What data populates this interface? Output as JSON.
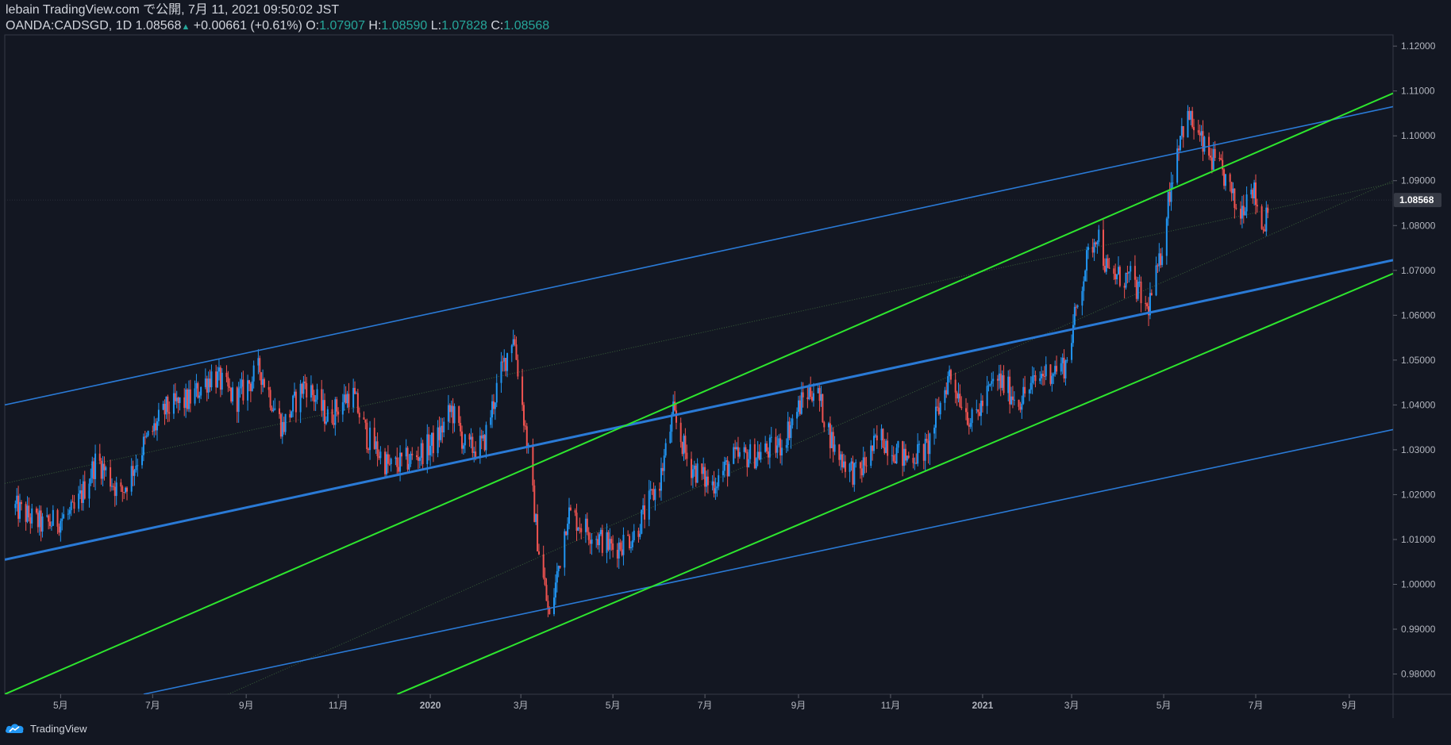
{
  "header": {
    "published": "lebain TradingView.com で公開, 7月 11, 2021 09:50:02 JST",
    "symbol": "OANDA:CADSGD, 1D",
    "last": "1.08568",
    "change_arrow": "▲",
    "change": "+0.00661 (+0.61%)",
    "o_label": "O:",
    "o_val": "1.07907",
    "h_label": "H:",
    "h_val": "1.08590",
    "l_label": "L:",
    "l_val": "1.07828",
    "c_label": "C:",
    "c_val": "1.08568"
  },
  "footer": {
    "brand": "TradingView",
    "logo_icon": "tradingview-cloud-icon"
  },
  "colors": {
    "background": "#131722",
    "up": "#2196f3",
    "down": "#ef5350",
    "blue_line": "#2a7ad6",
    "green_line": "#2ee62e",
    "axis_text": "#b2b5be"
  },
  "chart_data": {
    "type": "candlestick",
    "symbol": "OANDA:CADSGD",
    "interval": "1D",
    "last_price_label": "1.08568",
    "ylim": [
      0.9755,
      1.1225
    ],
    "y_ticks": [
      "1.12000",
      "1.11000",
      "1.10000",
      "1.09000",
      "1.08000",
      "1.07000",
      "1.06000",
      "1.05000",
      "1.04000",
      "1.03000",
      "1.02000",
      "1.01000",
      "1.00000",
      "0.99000",
      "0.98000"
    ],
    "x_ticks": [
      "5月",
      "7月",
      "9月",
      "11月",
      "2020",
      "3月",
      "5月",
      "7月",
      "9月",
      "11月",
      "2021",
      "3月",
      "5月",
      "7月",
      "9月"
    ],
    "close_path": [
      [
        "2019-04-01",
        1.017
      ],
      [
        "2019-04-20",
        1.013
      ],
      [
        "2019-05-10",
        1.016
      ],
      [
        "2019-05-25",
        1.028
      ],
      [
        "2019-06-10",
        1.02
      ],
      [
        "2019-06-25",
        1.031
      ],
      [
        "2019-07-10",
        1.039
      ],
      [
        "2019-07-25",
        1.041
      ],
      [
        "2019-08-10",
        1.047
      ],
      [
        "2019-08-25",
        1.041
      ],
      [
        "2019-09-10",
        1.048
      ],
      [
        "2019-09-25",
        1.035
      ],
      [
        "2019-10-10",
        1.045
      ],
      [
        "2019-10-25",
        1.037
      ],
      [
        "2019-11-10",
        1.043
      ],
      [
        "2019-11-20",
        1.033
      ],
      [
        "2019-12-05",
        1.026
      ],
      [
        "2019-12-20",
        1.028
      ],
      [
        "2020-01-05",
        1.032
      ],
      [
        "2020-01-15",
        1.039
      ],
      [
        "2020-01-25",
        1.03
      ],
      [
        "2020-02-05",
        1.031
      ],
      [
        "2020-02-15",
        1.045
      ],
      [
        "2020-02-25",
        1.056
      ],
      [
        "2020-03-05",
        1.032
      ],
      [
        "2020-03-12",
        1.01
      ],
      [
        "2020-03-20",
        0.992
      ],
      [
        "2020-04-01",
        1.016
      ],
      [
        "2020-04-15",
        1.012
      ],
      [
        "2020-05-01",
        1.008
      ],
      [
        "2020-05-15",
        1.011
      ],
      [
        "2020-06-01",
        1.023
      ],
      [
        "2020-06-10",
        1.038
      ],
      [
        "2020-06-20",
        1.027
      ],
      [
        "2020-07-05",
        1.022
      ],
      [
        "2020-07-20",
        1.028
      ],
      [
        "2020-08-05",
        1.029
      ],
      [
        "2020-08-20",
        1.031
      ],
      [
        "2020-09-05",
        1.042
      ],
      [
        "2020-09-12",
        1.044
      ],
      [
        "2020-09-25",
        1.03
      ],
      [
        "2020-10-10",
        1.024
      ],
      [
        "2020-10-25",
        1.033
      ],
      [
        "2020-11-10",
        1.028
      ],
      [
        "2020-11-25",
        1.03
      ],
      [
        "2020-12-10",
        1.047
      ],
      [
        "2020-12-25",
        1.036
      ],
      [
        "2021-01-10",
        1.046
      ],
      [
        "2021-01-25",
        1.041
      ],
      [
        "2021-02-10",
        1.047
      ],
      [
        "2021-02-25",
        1.049
      ],
      [
        "2021-03-10",
        1.071
      ],
      [
        "2021-03-18",
        1.079
      ],
      [
        "2021-03-25",
        1.069
      ],
      [
        "2021-04-10",
        1.068
      ],
      [
        "2021-04-20",
        1.061
      ],
      [
        "2021-04-28",
        1.071
      ],
      [
        "2021-05-05",
        1.088
      ],
      [
        "2021-05-12",
        1.101
      ],
      [
        "2021-05-18",
        1.104
      ],
      [
        "2021-05-28",
        1.097
      ],
      [
        "2021-06-10",
        1.091
      ],
      [
        "2021-06-20",
        1.082
      ],
      [
        "2021-06-28",
        1.09
      ],
      [
        "2021-07-06",
        1.079
      ],
      [
        "2021-07-09",
        1.0857
      ]
    ],
    "trend_lines": [
      {
        "color": "blue",
        "from": [
          "2019-03-25",
          1.04
        ],
        "to": [
          "2021-09-30",
          1.1065
        ],
        "width": 1.6
      },
      {
        "color": "blue",
        "from": [
          "2019-03-25",
          1.0055
        ],
        "to": [
          "2021-09-30",
          1.0723
        ],
        "width": 3
      },
      {
        "color": "blue",
        "from": [
          "2019-06-25",
          0.9755
        ],
        "to": [
          "2021-09-30",
          1.0345
        ],
        "width": 1.6
      },
      {
        "color": "green",
        "from": [
          "2019-03-25",
          0.9755
        ],
        "to": [
          "2021-09-30",
          1.1095
        ],
        "width": 2
      },
      {
        "color": "green",
        "from": [
          "2019-12-10",
          0.9755
        ],
        "to": [
          "2021-09-30",
          1.0693
        ],
        "width": 2
      }
    ],
    "median_lines": [
      {
        "from": [
          "2019-03-25",
          1.0225
        ],
        "to": [
          "2021-09-30",
          1.0895
        ]
      },
      {
        "from": [
          "2019-08-20",
          0.9755
        ],
        "to": [
          "2021-09-30",
          1.09
        ]
      }
    ]
  }
}
